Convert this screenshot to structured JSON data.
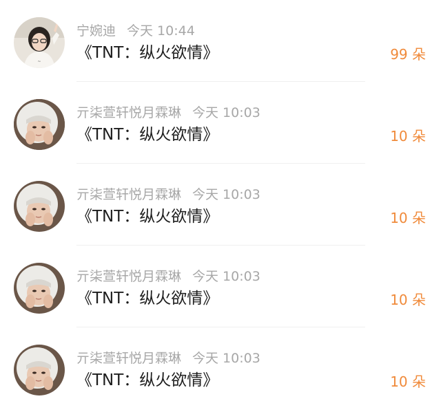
{
  "gifts": [
    {
      "user": "宁婉迪",
      "time": "今天 10:44",
      "title": "《TNT：纵火欲情》",
      "count": "99 朵",
      "avatar": "girl-peace-sign-avatar"
    },
    {
      "user": "亓柒萱轩悦月霖琳",
      "time": "今天 10:03",
      "title": "《TNT：纵火欲情》",
      "count": "10 朵",
      "avatar": "hooded-person-avatar"
    },
    {
      "user": "亓柒萱轩悦月霖琳",
      "time": "今天 10:03",
      "title": "《TNT：纵火欲情》",
      "count": "10 朵",
      "avatar": "hooded-person-avatar"
    },
    {
      "user": "亓柒萱轩悦月霖琳",
      "time": "今天 10:03",
      "title": "《TNT：纵火欲情》",
      "count": "10 朵",
      "avatar": "hooded-person-avatar"
    },
    {
      "user": "亓柒萱轩悦月霖琳",
      "time": "今天 10:03",
      "title": "《TNT：纵火欲情》",
      "count": "10 朵",
      "avatar": "hooded-person-avatar"
    }
  ],
  "colors": {
    "count": "#f08a3a",
    "meta": "#a7a7a7",
    "title": "#1d1d1d"
  }
}
